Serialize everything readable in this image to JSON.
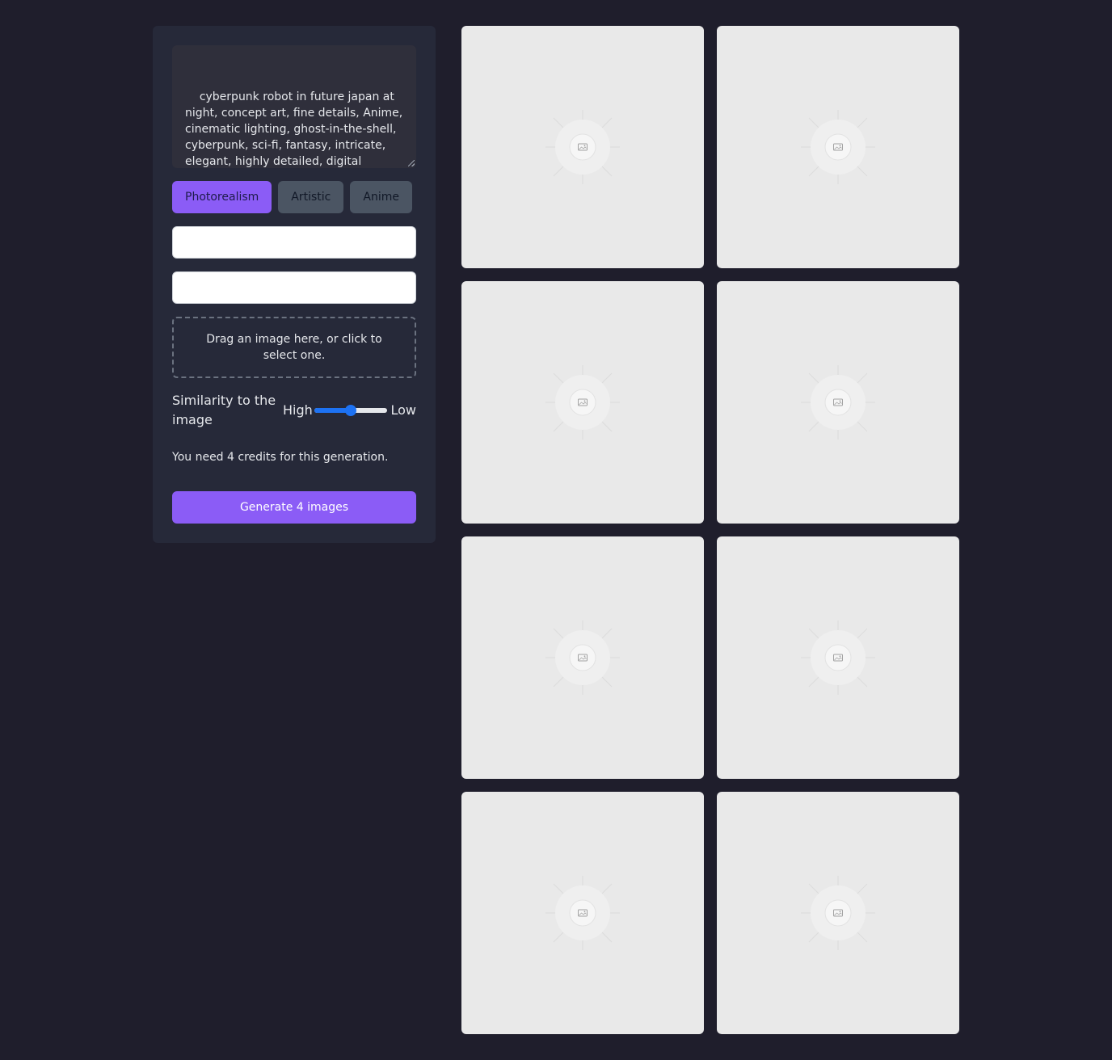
{
  "prompt": {
    "value": "cyberpunk robot in future japan at night, concept art, fine details, Anime, cinematic lighting, ghost-in-the-shell, cyberpunk, sci-fi, fantasy, intricate, elegant, highly detailed, digital painting, artstation, concept art, smooth, sharp focus, illustration"
  },
  "styles": {
    "items": [
      {
        "label": "Photorealism",
        "active": true
      },
      {
        "label": "Artistic",
        "active": false
      },
      {
        "label": "Anime",
        "active": false
      }
    ]
  },
  "inputs": {
    "first": {
      "value": "",
      "placeholder": ""
    },
    "second": {
      "value": "",
      "placeholder": ""
    }
  },
  "dropzone": {
    "text": "Drag an image here, or click to select one."
  },
  "similarity": {
    "label": "Similarity to the image",
    "high_label": "High",
    "low_label": "Low",
    "value": 0.5
  },
  "credits_text": "You need 4 credits for this generation.",
  "generate_label": "Generate 4 images",
  "gallery": {
    "tiles": [
      {
        "icon": "image-placeholder-icon"
      },
      {
        "icon": "image-placeholder-icon"
      },
      {
        "icon": "image-placeholder-icon"
      },
      {
        "icon": "image-placeholder-icon"
      },
      {
        "icon": "image-placeholder-icon"
      },
      {
        "icon": "image-placeholder-icon"
      },
      {
        "icon": "image-placeholder-icon"
      },
      {
        "icon": "image-placeholder-icon"
      }
    ]
  },
  "colors": {
    "background": "#1f1e2c",
    "panel": "#262939",
    "accent": "#8b5cf6",
    "slider": "#1d72f3",
    "tile": "#e9e9e9"
  }
}
